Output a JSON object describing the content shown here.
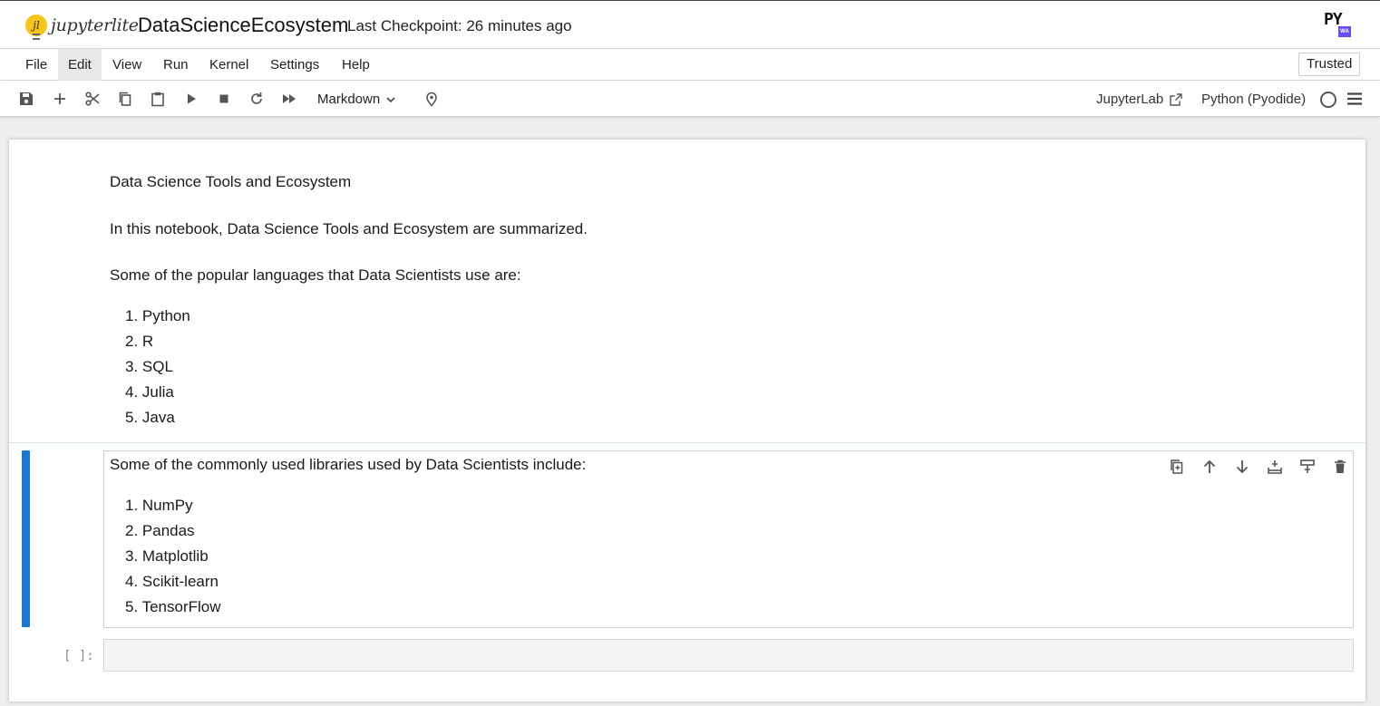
{
  "header": {
    "logo_text": "jupyterlite",
    "notebook_title": "DataScienceEcosystem",
    "checkpoint": "Last Checkpoint: 26 minutes ago",
    "py_logo_text": "PY",
    "py_logo_badge": "WA"
  },
  "menu": {
    "items": [
      "File",
      "Edit",
      "View",
      "Run",
      "Kernel",
      "Settings",
      "Help"
    ],
    "trusted": "Trusted"
  },
  "toolbar": {
    "cell_type": "Markdown",
    "jupyterlab_link": "JupyterLab",
    "kernel": "Python (Pyodide)"
  },
  "cells": {
    "md1": {
      "title": "Data Science Tools and Ecosystem",
      "intro": "In this notebook, Data Science Tools and Ecosystem are summarized.",
      "languages_heading": "Some of the popular languages that Data Scientists use are:",
      "languages": [
        "1. Python",
        "2. R",
        "3. SQL",
        "4. Julia",
        "5. Java"
      ]
    },
    "md2": {
      "libraries_heading": "Some of the commonly used libraries used by Data Scientists include:",
      "libraries": [
        "1. NumPy",
        "2. Pandas",
        "3. Matplotlib",
        "4. Scikit-learn",
        "5. TensorFlow"
      ]
    },
    "code": {
      "prompt": "[ ]:"
    }
  }
}
